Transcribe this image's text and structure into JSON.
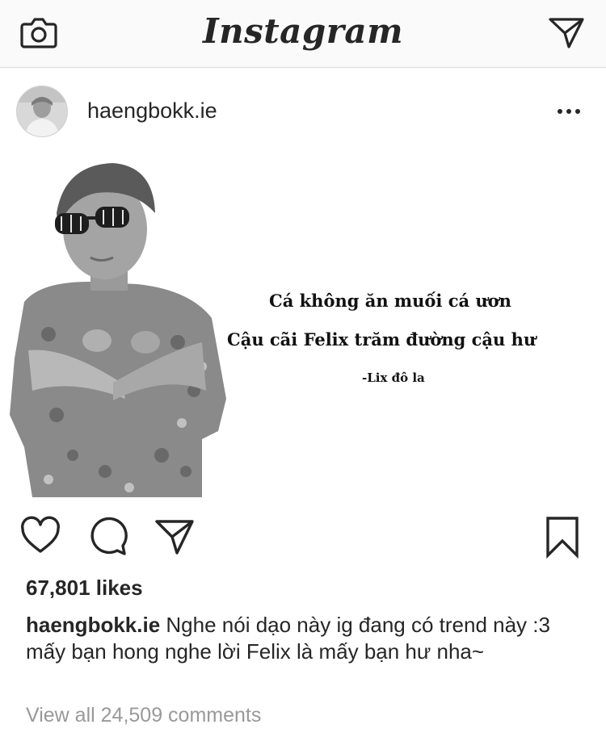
{
  "app": {
    "logo_text": "Instagram",
    "icons": {
      "camera": "camera-icon",
      "direct": "paper-plane-icon",
      "more": "more-options-icon",
      "like": "heart-icon",
      "comment": "comment-bubble-icon",
      "share": "paper-plane-icon",
      "save": "bookmark-icon"
    }
  },
  "post": {
    "username": "haengbokk.ie",
    "image": {
      "quote_line1": "Cá không ăn muối cá ươn",
      "quote_line2": "Cậu cãi Felix trăm đường cậu hư",
      "signature": "-Lix đô la"
    },
    "likes": "67,801 likes",
    "caption_user": "haengbokk.ie",
    "caption_text": "Nghe nói dạo này ig đang có trend này :3 mấy bạn hong nghe lời Felix là mấy bạn hư nha~",
    "view_comments": "View all 24,509 comments"
  },
  "colors": {
    "text": "#262626",
    "muted": "#999999",
    "bar_bg": "#fafafa",
    "divider": "#dbdbdb"
  }
}
